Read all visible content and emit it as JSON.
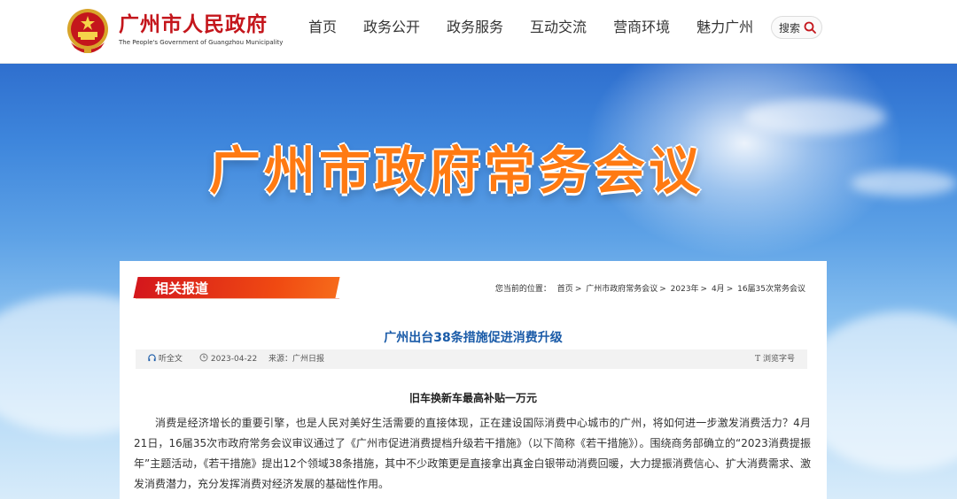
{
  "header": {
    "site_name_cn": "广州市人民政府",
    "site_name_en": "The People's Government of Guangzhou Municipality",
    "nav": [
      {
        "label": "首页"
      },
      {
        "label": "政务公开"
      },
      {
        "label": "政务服务"
      },
      {
        "label": "互动交流"
      },
      {
        "label": "营商环境"
      },
      {
        "label": "魅力广州"
      }
    ],
    "search_label": "搜索",
    "search_icon": "search-icon"
  },
  "banner": {
    "title": "广州市政府常务会议"
  },
  "section": {
    "tag": "相关报道",
    "breadcrumb_prefix": "您当前的位置：",
    "breadcrumb": [
      "首页",
      "广州市政府常务会议",
      "2023年",
      "4月",
      "16届35次常务会议"
    ]
  },
  "article": {
    "title": "广州出台38条措施促进消费升级",
    "listen_label": "听全文",
    "date": "2023-04-22",
    "source": "来源：广州日报",
    "font_size_label": "浏览字号",
    "subhead": "旧车换新车最高补贴一万元",
    "paragraph": "消费是经济增长的重要引擎，也是人民对美好生活需要的直接体现，正在建设国际消费中心城市的广州，将如何进一步激发消费活力？4月21日，16届35次市政府常务会议审议通过了《广州市促进消费提档升级若干措施》（以下简称《若干措施》）。围绕商务部确立的“2023消费提振年”主题活动，《若干措施》提出12个领域38条措施，其中不少政策更是直接拿出真金白银带动消费回暖，大力提振消费信心、扩大消费需求、激发消费潜力，充分发挥消费对经济发展的基础性作用。"
  },
  "colors": {
    "brand_red": "#c4161c",
    "tag_orange": "#f04a12",
    "title_blue": "#1a5ba8",
    "banner_orange": "#ff7a12"
  }
}
